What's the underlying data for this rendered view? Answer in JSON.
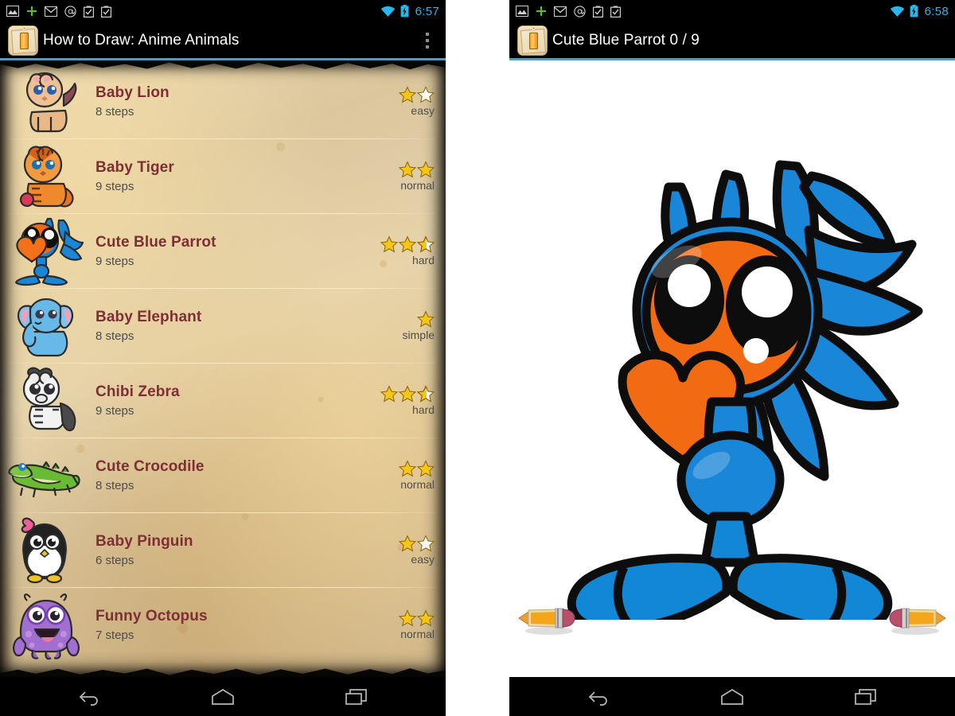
{
  "left_screen": {
    "status_bar": {
      "time": "6:57",
      "icons": [
        "image-icon",
        "plus-icon",
        "gmail-icon",
        "at-icon",
        "clipboard-check-icon",
        "clipboard-check-icon"
      ],
      "right_icons": [
        "wifi-icon",
        "battery-charging-icon"
      ],
      "accent_color": "#29b6e8"
    },
    "action_bar": {
      "app_icon": "pencil-paper-icon",
      "title": "How to Draw: Anime Animals",
      "overflow": "overflow-menu-icon",
      "underline_color": "#2aa8e0"
    },
    "list": [
      {
        "title": "Baby Lion",
        "steps": "8 steps",
        "difficulty": "easy",
        "stars_full": 1,
        "stars_half": 0,
        "stars_empty": 1,
        "thumb": "baby-lion-icon"
      },
      {
        "title": "Baby Tiger",
        "steps": "9 steps",
        "difficulty": "normal",
        "stars_full": 2,
        "stars_half": 0,
        "stars_empty": 0,
        "thumb": "baby-tiger-icon"
      },
      {
        "title": "Cute Blue Parrot",
        "steps": "9 steps",
        "difficulty": "hard",
        "stars_full": 2,
        "stars_half": 1,
        "stars_empty": 0,
        "thumb": "cute-blue-parrot-icon"
      },
      {
        "title": "Baby Elephant",
        "steps": "8 steps",
        "difficulty": "simple",
        "stars_full": 1,
        "stars_half": 0,
        "stars_empty": 0,
        "thumb": "baby-elephant-icon"
      },
      {
        "title": "Chibi Zebra",
        "steps": "9 steps",
        "difficulty": "hard",
        "stars_full": 2,
        "stars_half": 1,
        "stars_empty": 0,
        "thumb": "chibi-zebra-icon"
      },
      {
        "title": "Cute Crocodile",
        "steps": "8 steps",
        "difficulty": "normal",
        "stars_full": 2,
        "stars_half": 0,
        "stars_empty": 0,
        "thumb": "cute-crocodile-icon"
      },
      {
        "title": "Baby Pinguin",
        "steps": "6 steps",
        "difficulty": "easy",
        "stars_full": 1,
        "stars_half": 0,
        "stars_empty": 1,
        "thumb": "baby-pinguin-icon"
      },
      {
        "title": "Funny Octopus",
        "steps": "7 steps",
        "difficulty": "normal",
        "stars_full": 2,
        "stars_half": 0,
        "stars_empty": 0,
        "thumb": "funny-octopus-icon"
      }
    ],
    "nav_bar": {
      "back": "back-icon",
      "home": "home-icon",
      "recents": "recents-icon"
    }
  },
  "right_screen": {
    "status_bar": {
      "time": "6:58",
      "icons": [
        "image-icon",
        "plus-icon",
        "gmail-icon",
        "at-icon",
        "clipboard-check-icon",
        "clipboard-check-icon"
      ],
      "right_icons": [
        "wifi-icon",
        "battery-charging-icon"
      ],
      "accent_color": "#29b6e8"
    },
    "action_bar": {
      "app_icon": "pencil-paper-icon",
      "title": "Cute Blue Parrot 0 / 9",
      "underline_color": "#2aa8e0"
    },
    "canvas": {
      "drawing": "cute-blue-parrot-drawing",
      "prev_button": "pencil-previous-button",
      "next_button": "pencil-next-button",
      "background": "#ffffff"
    },
    "nav_bar": {
      "back": "back-icon",
      "home": "home-icon",
      "recents": "recents-icon"
    }
  },
  "colors": {
    "title_text": "#7d2f34",
    "subtitle_text": "#4c4c4c",
    "star_gold": "#f5c518",
    "star_empty": "#ffffff",
    "parrot_blue": "#1a86d8",
    "parrot_orange": "#f26a12"
  }
}
